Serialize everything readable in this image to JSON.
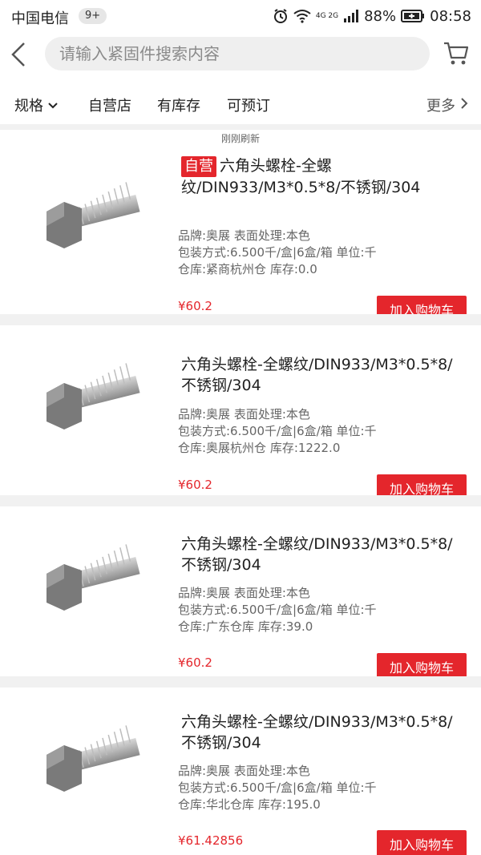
{
  "status_bar": {
    "carrier": "中国电信",
    "notification_badge": "9+",
    "network": "4G 2G",
    "battery": "88%",
    "time": "08:58"
  },
  "search": {
    "placeholder": "请输入紧固件搜索内容"
  },
  "filters": {
    "spec": "规格",
    "self_operated": "自营店",
    "in_stock": "有库存",
    "preorder": "可预订",
    "more": "更多"
  },
  "refresh_note": "刚刚刷新",
  "products": [
    {
      "self_badge": "自营",
      "title": "六角头螺栓-全螺纹/DIN933/M3*0.5*8/不锈钢/304",
      "spec1": "品牌:奥展  表面处理:本色",
      "spec2": "包装方式:6.500千/盒|6盒/箱  单位:千",
      "spec3": "仓库:紧商杭州仓  库存:0.0",
      "price": "¥60.2",
      "button": "加入购物车"
    },
    {
      "self_badge": "",
      "title": "六角头螺栓-全螺纹/DIN933/M3*0.5*8/不锈钢/304",
      "spec1": "品牌:奥展  表面处理:本色",
      "spec2": "包装方式:6.500千/盒|6盒/箱  单位:千",
      "spec3": "仓库:奥展杭州仓  库存:1222.0",
      "price": "¥60.2",
      "button": "加入购物车"
    },
    {
      "self_badge": "",
      "title": "六角头螺栓-全螺纹/DIN933/M3*0.5*8/不锈钢/304",
      "spec1": "品牌:奥展  表面处理:本色",
      "spec2": "包装方式:6.500千/盒|6盒/箱  单位:千",
      "spec3": "仓库:广东仓库  库存:39.0",
      "price": "¥60.2",
      "button": "加入购物车"
    },
    {
      "self_badge": "",
      "title": "六角头螺栓-全螺纹/DIN933/M3*0.5*8/不锈钢/304",
      "spec1": "品牌:奥展  表面处理:本色",
      "spec2": "包装方式:6.500千/盒|6盒/箱  单位:千",
      "spec3": "仓库:华北仓库  库存:195.0",
      "price": "¥61.42856",
      "button": "加入购物车"
    }
  ],
  "colors": {
    "accent": "#e4262c",
    "secondary_text": "#666666",
    "separator": "#f1f1f1"
  }
}
